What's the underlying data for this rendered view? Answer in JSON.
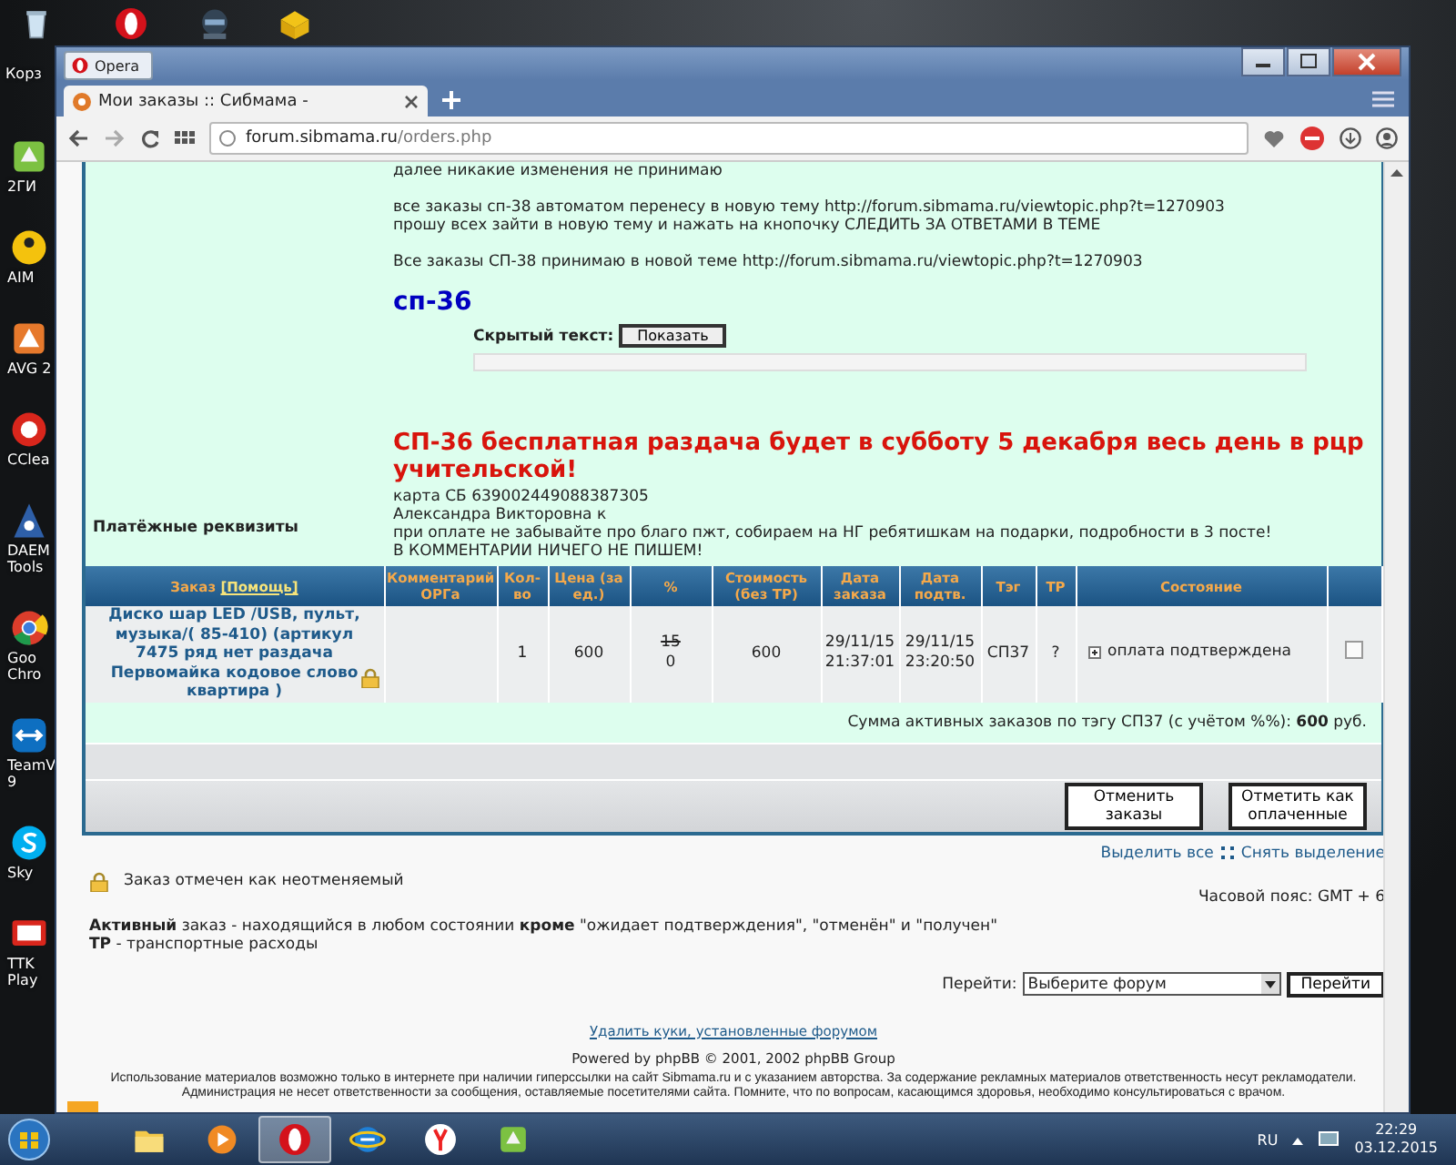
{
  "desktop": {
    "top_icons": [
      {
        "kind": "bin",
        "label": "Корз"
      },
      {
        "kind": "opera"
      },
      {
        "kind": "game"
      },
      {
        "kind": "box"
      }
    ],
    "side_icons": [
      {
        "kind": "map",
        "label": "2ГИ"
      },
      {
        "kind": "aim",
        "label": "AIM"
      },
      {
        "kind": "avg",
        "label": "AVG 2"
      },
      {
        "kind": "ccleaner",
        "label": "CClea"
      },
      {
        "kind": "daemon",
        "label": "DAEM Tools"
      },
      {
        "kind": "chrome",
        "label": "Goo Chro"
      },
      {
        "kind": "teamviewer",
        "label": "TeamV 9"
      },
      {
        "kind": "skype",
        "label": "Sky"
      },
      {
        "kind": "tv",
        "label": "TTK Play"
      }
    ]
  },
  "browser": {
    "menu_button": "Opera",
    "tab": {
      "title": "Мои заказы :: Сибмама -",
      "selected": true
    },
    "address": {
      "host": "forum.sibmama.ru",
      "path": "/orders.php"
    }
  },
  "post": {
    "paragraphs": [
      [
        "далее никакие изменения не принимаю"
      ],
      [
        "все заказы сп-38 автоматом перенесу в новую тему http://forum.sibmama.ru/viewtopic.php?t=1270903",
        "прошу всех зайти в новую тему и нажать на кнопочку СЛЕДИТЬ ЗА ОТВЕТАМИ В ТЕМЕ"
      ],
      [
        "Все заказы СП-38 принимаю в новой теме http://forum.sibmama.ru/viewtopic.php?t=1270903"
      ]
    ],
    "heading": "сп-36",
    "hidden_text": {
      "label": "Скрытый текст:",
      "button": "Показать"
    },
    "announcement": "СП-36 бесплатная раздача будет в субботу 5 декабря весь день в рцр учительской!"
  },
  "payment": {
    "label": "Платёжные реквизиты",
    "lines": [
      "карта СБ 639002449088387305",
      "Александра Викторовна к",
      "при оплате не забывайте про благо пжт, собираем на НГ ребятишкам на подарки, подробности в 3 посте!",
      "В КОММЕНТАРИИ НИЧЕГО НЕ ПИШЕМ!"
    ]
  },
  "table": {
    "help_link": "[Помощь]",
    "columns": [
      "Заказ",
      "Комментарий ОРГа",
      "Кол-во",
      "Цена (за ед.)",
      "%",
      "Стоимость (без ТР)",
      "Дата заказа",
      "Дата подтв.",
      "Тэг",
      "ТР",
      "Состояние"
    ],
    "rows": [
      {
        "title": "Диско шар LED /USB, пульт, музыка/( 85-410) (артикул 7475 ряд нет раздача Первомайка кодовое слово квартира )",
        "locked": true,
        "qty": "1",
        "price": "600",
        "percent_old": "15",
        "percent": "0",
        "cost": "600",
        "date_order": "29/11/15 21:37:01",
        "date_confirm": "29/11/15 23:20:50",
        "tag": "СП37",
        "tr": "?",
        "status": "оплата подтверждена",
        "expanded": false,
        "checked": false
      }
    ],
    "sum": "Сумма активных заказов по тэгу СП37 (с учётом %%): **600** руб.",
    "buttons": [
      "Отменить заказы",
      "Отметить как оплаченные"
    ]
  },
  "select_all": "Выделить все",
  "deselect": "Снять выделение",
  "legend": "Заказ отмечен как неотменяемый",
  "timezone": "Часовой пояс: GMT + 6",
  "definitions": [
    "**Активный** заказ - находящийся в любом состоянии **кроме** \"ожидает подтверждения\", \"отменён\" и \"получен\"",
    "**ТР** - транспортные расходы"
  ],
  "jump": {
    "label": "Перейти:",
    "value": "Выберите форум",
    "button": "Перейти"
  },
  "footer": {
    "link": "Удалить куки, установленные форумом",
    "powered": "Powered by phpBB © 2001, 2002 phpBB Group",
    "disclaimer": "Использование материалов возможно только в интернете при наличии гиперссылки на сайт Sibmama.ru и с указанием авторства. За содержание рекламных материалов ответственность несут рекламодатели. Администрация не несет ответственности за сообщения, оставляемые посетителями сайта. Помните, что по вопросам, касающимся здоровья, необходимо консультироваться с врачом."
  },
  "taskbar": {
    "apps": [
      {
        "kind": "folder",
        "active": false
      },
      {
        "kind": "media",
        "active": false
      },
      {
        "kind": "opera",
        "active": true
      },
      {
        "kind": "ie",
        "active": false
      },
      {
        "kind": "yandex",
        "active": false
      },
      {
        "kind": "map",
        "active": false
      }
    ],
    "language": "RU",
    "time": "22:29",
    "date": "03.12.2015"
  }
}
